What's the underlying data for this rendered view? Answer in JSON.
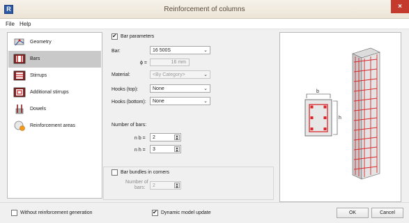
{
  "window": {
    "title": "Reinforcement of columns",
    "close_glyph": "×",
    "app_glyph": "R"
  },
  "menu": {
    "file": "File",
    "help": "Help"
  },
  "nav": {
    "items": [
      {
        "label": "Geometry",
        "icon": "geometry-icon",
        "selected": false
      },
      {
        "label": "Bars",
        "icon": "bars-icon",
        "selected": true
      },
      {
        "label": "Stirrups",
        "icon": "stirrups-icon",
        "selected": false
      },
      {
        "label": "Additional stirrups",
        "icon": "additional-stirrups-icon",
        "selected": false
      },
      {
        "label": "Dowels",
        "icon": "dowels-icon",
        "selected": false
      },
      {
        "label": "Reinforcement areas",
        "icon": "reinforcement-areas-icon",
        "selected": false
      }
    ]
  },
  "bar_params": {
    "section_label": "Bar parameters",
    "section_checked": true,
    "bar_label": "Bar:",
    "bar_value": "16 500S",
    "diameter_label": "ϕ =",
    "diameter_value": "16 mm",
    "material_label": "Material:",
    "material_value": "<By Category>",
    "hooks_top_label": "Hooks (top):",
    "hooks_top_value": "None",
    "hooks_bottom_label": "Hooks (bottom):",
    "hooks_bottom_value": "None"
  },
  "number_of_bars": {
    "label": "Number of bars:",
    "nb_label": "n b =",
    "nb_value": "2",
    "nh_label": "n h =",
    "nh_value": "3"
  },
  "bundles": {
    "label": "Bar bundles in corners",
    "checked": false,
    "count_label_1": "Number of",
    "count_label_2": "bars:",
    "count_value": "2"
  },
  "preview": {
    "dim_b": "b",
    "dim_h": "h"
  },
  "footer": {
    "without_generation_label": "Without reinforcement generation",
    "without_generation_checked": false,
    "dynamic_update_label": "Dynamic model update",
    "dynamic_update_checked": true,
    "ok_label": "OK",
    "cancel_label": "Cancel"
  },
  "colors": {
    "rebar": "#d9262b",
    "selected_nav": "#c9c9c9",
    "close": "#c43a2d"
  }
}
